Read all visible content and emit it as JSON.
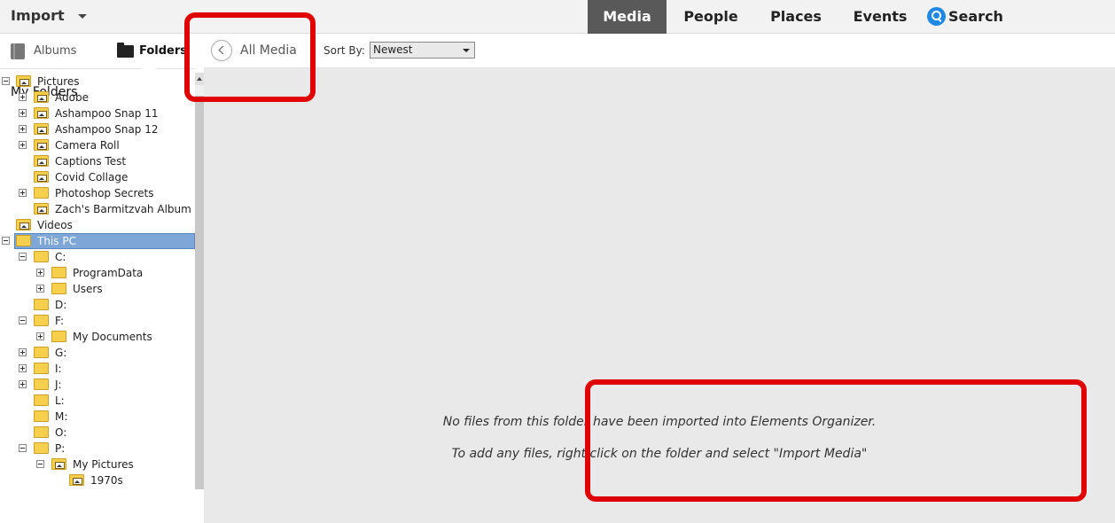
{
  "topbar": {
    "import_label": "Import",
    "tabs": [
      {
        "label": "Media",
        "active": true
      },
      {
        "label": "People",
        "active": false
      },
      {
        "label": "Places",
        "active": false
      },
      {
        "label": "Events",
        "active": false
      },
      {
        "label": "Search",
        "active": false,
        "icon": "search-icon"
      }
    ]
  },
  "left_panel": {
    "tabs": [
      {
        "label": "Albums",
        "icon": "album-icon",
        "active": false
      },
      {
        "label": "Folders",
        "icon": "folder-icon",
        "active": true
      }
    ],
    "heading": "My Folders",
    "tree": [
      {
        "label": "Pictures",
        "level": 0,
        "expander": "minus",
        "icon": "picture-folder-icon"
      },
      {
        "label": "Adobe",
        "level": 1,
        "expander": "plus",
        "icon": "picture-folder-icon"
      },
      {
        "label": "Ashampoo Snap 11",
        "level": 1,
        "expander": "plus",
        "icon": "picture-folder-icon"
      },
      {
        "label": "Ashampoo Snap 12",
        "level": 1,
        "expander": "plus",
        "icon": "picture-folder-icon"
      },
      {
        "label": "Camera Roll",
        "level": 1,
        "expander": "plus",
        "icon": "picture-folder-icon"
      },
      {
        "label": "Captions Test",
        "level": 1,
        "expander": "none",
        "icon": "picture-folder-icon"
      },
      {
        "label": "Covid Collage",
        "level": 1,
        "expander": "none",
        "icon": "picture-folder-icon"
      },
      {
        "label": "Photoshop Secrets",
        "level": 1,
        "expander": "plus",
        "icon": "folder-icon"
      },
      {
        "label": "Zach's Barmitzvah Album",
        "level": 1,
        "expander": "none",
        "icon": "picture-folder-icon"
      },
      {
        "label": "Videos",
        "level": 0,
        "expander": "none",
        "icon": "picture-folder-icon"
      },
      {
        "label": "This PC",
        "level": 0,
        "expander": "minus",
        "icon": "folder-icon",
        "selected": true
      },
      {
        "label": "C:",
        "level": 1,
        "expander": "minus",
        "icon": "folder-icon"
      },
      {
        "label": "ProgramData",
        "level": 2,
        "expander": "plus",
        "icon": "folder-icon"
      },
      {
        "label": "Users",
        "level": 2,
        "expander": "plus",
        "icon": "folder-icon"
      },
      {
        "label": "D:",
        "level": 1,
        "expander": "none",
        "icon": "folder-icon"
      },
      {
        "label": "F:",
        "level": 1,
        "expander": "minus",
        "icon": "folder-icon"
      },
      {
        "label": "My Documents",
        "level": 2,
        "expander": "plus",
        "icon": "folder-icon"
      },
      {
        "label": "G:",
        "level": 1,
        "expander": "plus",
        "icon": "folder-icon"
      },
      {
        "label": "I:",
        "level": 1,
        "expander": "plus",
        "icon": "folder-icon"
      },
      {
        "label": "J:",
        "level": 1,
        "expander": "plus",
        "icon": "folder-icon"
      },
      {
        "label": "L:",
        "level": 1,
        "expander": "none",
        "icon": "folder-icon"
      },
      {
        "label": "M:",
        "level": 1,
        "expander": "none",
        "icon": "folder-icon"
      },
      {
        "label": "O:",
        "level": 1,
        "expander": "none",
        "icon": "folder-icon"
      },
      {
        "label": "P:",
        "level": 1,
        "expander": "minus",
        "icon": "folder-icon"
      },
      {
        "label": "My Pictures",
        "level": 2,
        "expander": "minus",
        "icon": "picture-folder-icon"
      },
      {
        "label": "1970s",
        "level": 3,
        "expander": "none",
        "icon": "picture-folder-icon"
      }
    ]
  },
  "main": {
    "back_label": "All Media",
    "sort_label": "Sort By:",
    "sort_value": "Newest",
    "message_line1": "No files from this folder have been imported into Elements Organizer.",
    "message_line2": "To add any files, right click on the folder and select \"Import Media\""
  },
  "annotation_color": "#e00000"
}
